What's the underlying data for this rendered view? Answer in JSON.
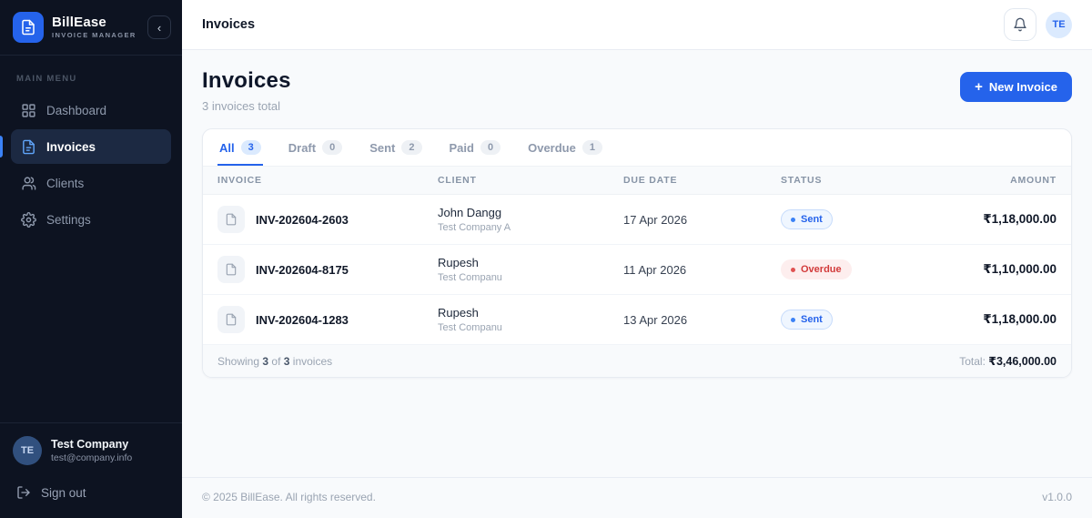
{
  "app": {
    "name": "BillEase",
    "subtitle": "INVOICE MANAGER"
  },
  "icons": {
    "collapse": "‹",
    "plus": "+"
  },
  "sidebar": {
    "section_label": "MAIN MENU",
    "items": [
      {
        "label": "Dashboard"
      },
      {
        "label": "Invoices"
      },
      {
        "label": "Clients"
      },
      {
        "label": "Settings"
      }
    ],
    "user": {
      "initials": "TE",
      "name": "Test Company",
      "email": "test@company.info"
    },
    "signout_label": "Sign out"
  },
  "topbar": {
    "title": "Invoices",
    "avatar_initials": "TE"
  },
  "page": {
    "title": "Invoices",
    "subtitle": "3 invoices total",
    "new_invoice_label": "New Invoice"
  },
  "tabs": [
    {
      "label": "All",
      "count": "3"
    },
    {
      "label": "Draft",
      "count": "0"
    },
    {
      "label": "Sent",
      "count": "2"
    },
    {
      "label": "Paid",
      "count": "0"
    },
    {
      "label": "Overdue",
      "count": "1"
    }
  ],
  "table": {
    "headers": [
      "INVOICE",
      "CLIENT",
      "DUE DATE",
      "STATUS",
      "AMOUNT"
    ],
    "rows": [
      {
        "invoice": "INV-202604-2603",
        "client": "John Dangg",
        "company": "Test Company A",
        "due": "17 Apr 2026",
        "status": "Sent",
        "amount": "₹1,18,000.00"
      },
      {
        "invoice": "INV-202604-8175",
        "client": "Rupesh",
        "company": "Test Companu",
        "due": "11 Apr 2026",
        "status": "Overdue",
        "amount": "₹1,10,000.00"
      },
      {
        "invoice": "INV-202604-1283",
        "client": "Rupesh",
        "company": "Test Companu",
        "due": "13 Apr 2026",
        "status": "Sent",
        "amount": "₹1,18,000.00"
      }
    ],
    "footer": {
      "showing": "Showing",
      "shown": "3",
      "of": "of",
      "total_count": "3",
      "suffix": "invoices",
      "total_label": "Total:",
      "total_amount": "₹3,46,000.00"
    }
  },
  "footer": {
    "copyright": "© 2025 BillEase. All rights reserved.",
    "version": "v1.0.0"
  },
  "colors": {
    "accent": "#2563eb",
    "sent": "#2563eb",
    "overdue": "#d23b3b",
    "sidebar_bg": "#0d1321"
  }
}
